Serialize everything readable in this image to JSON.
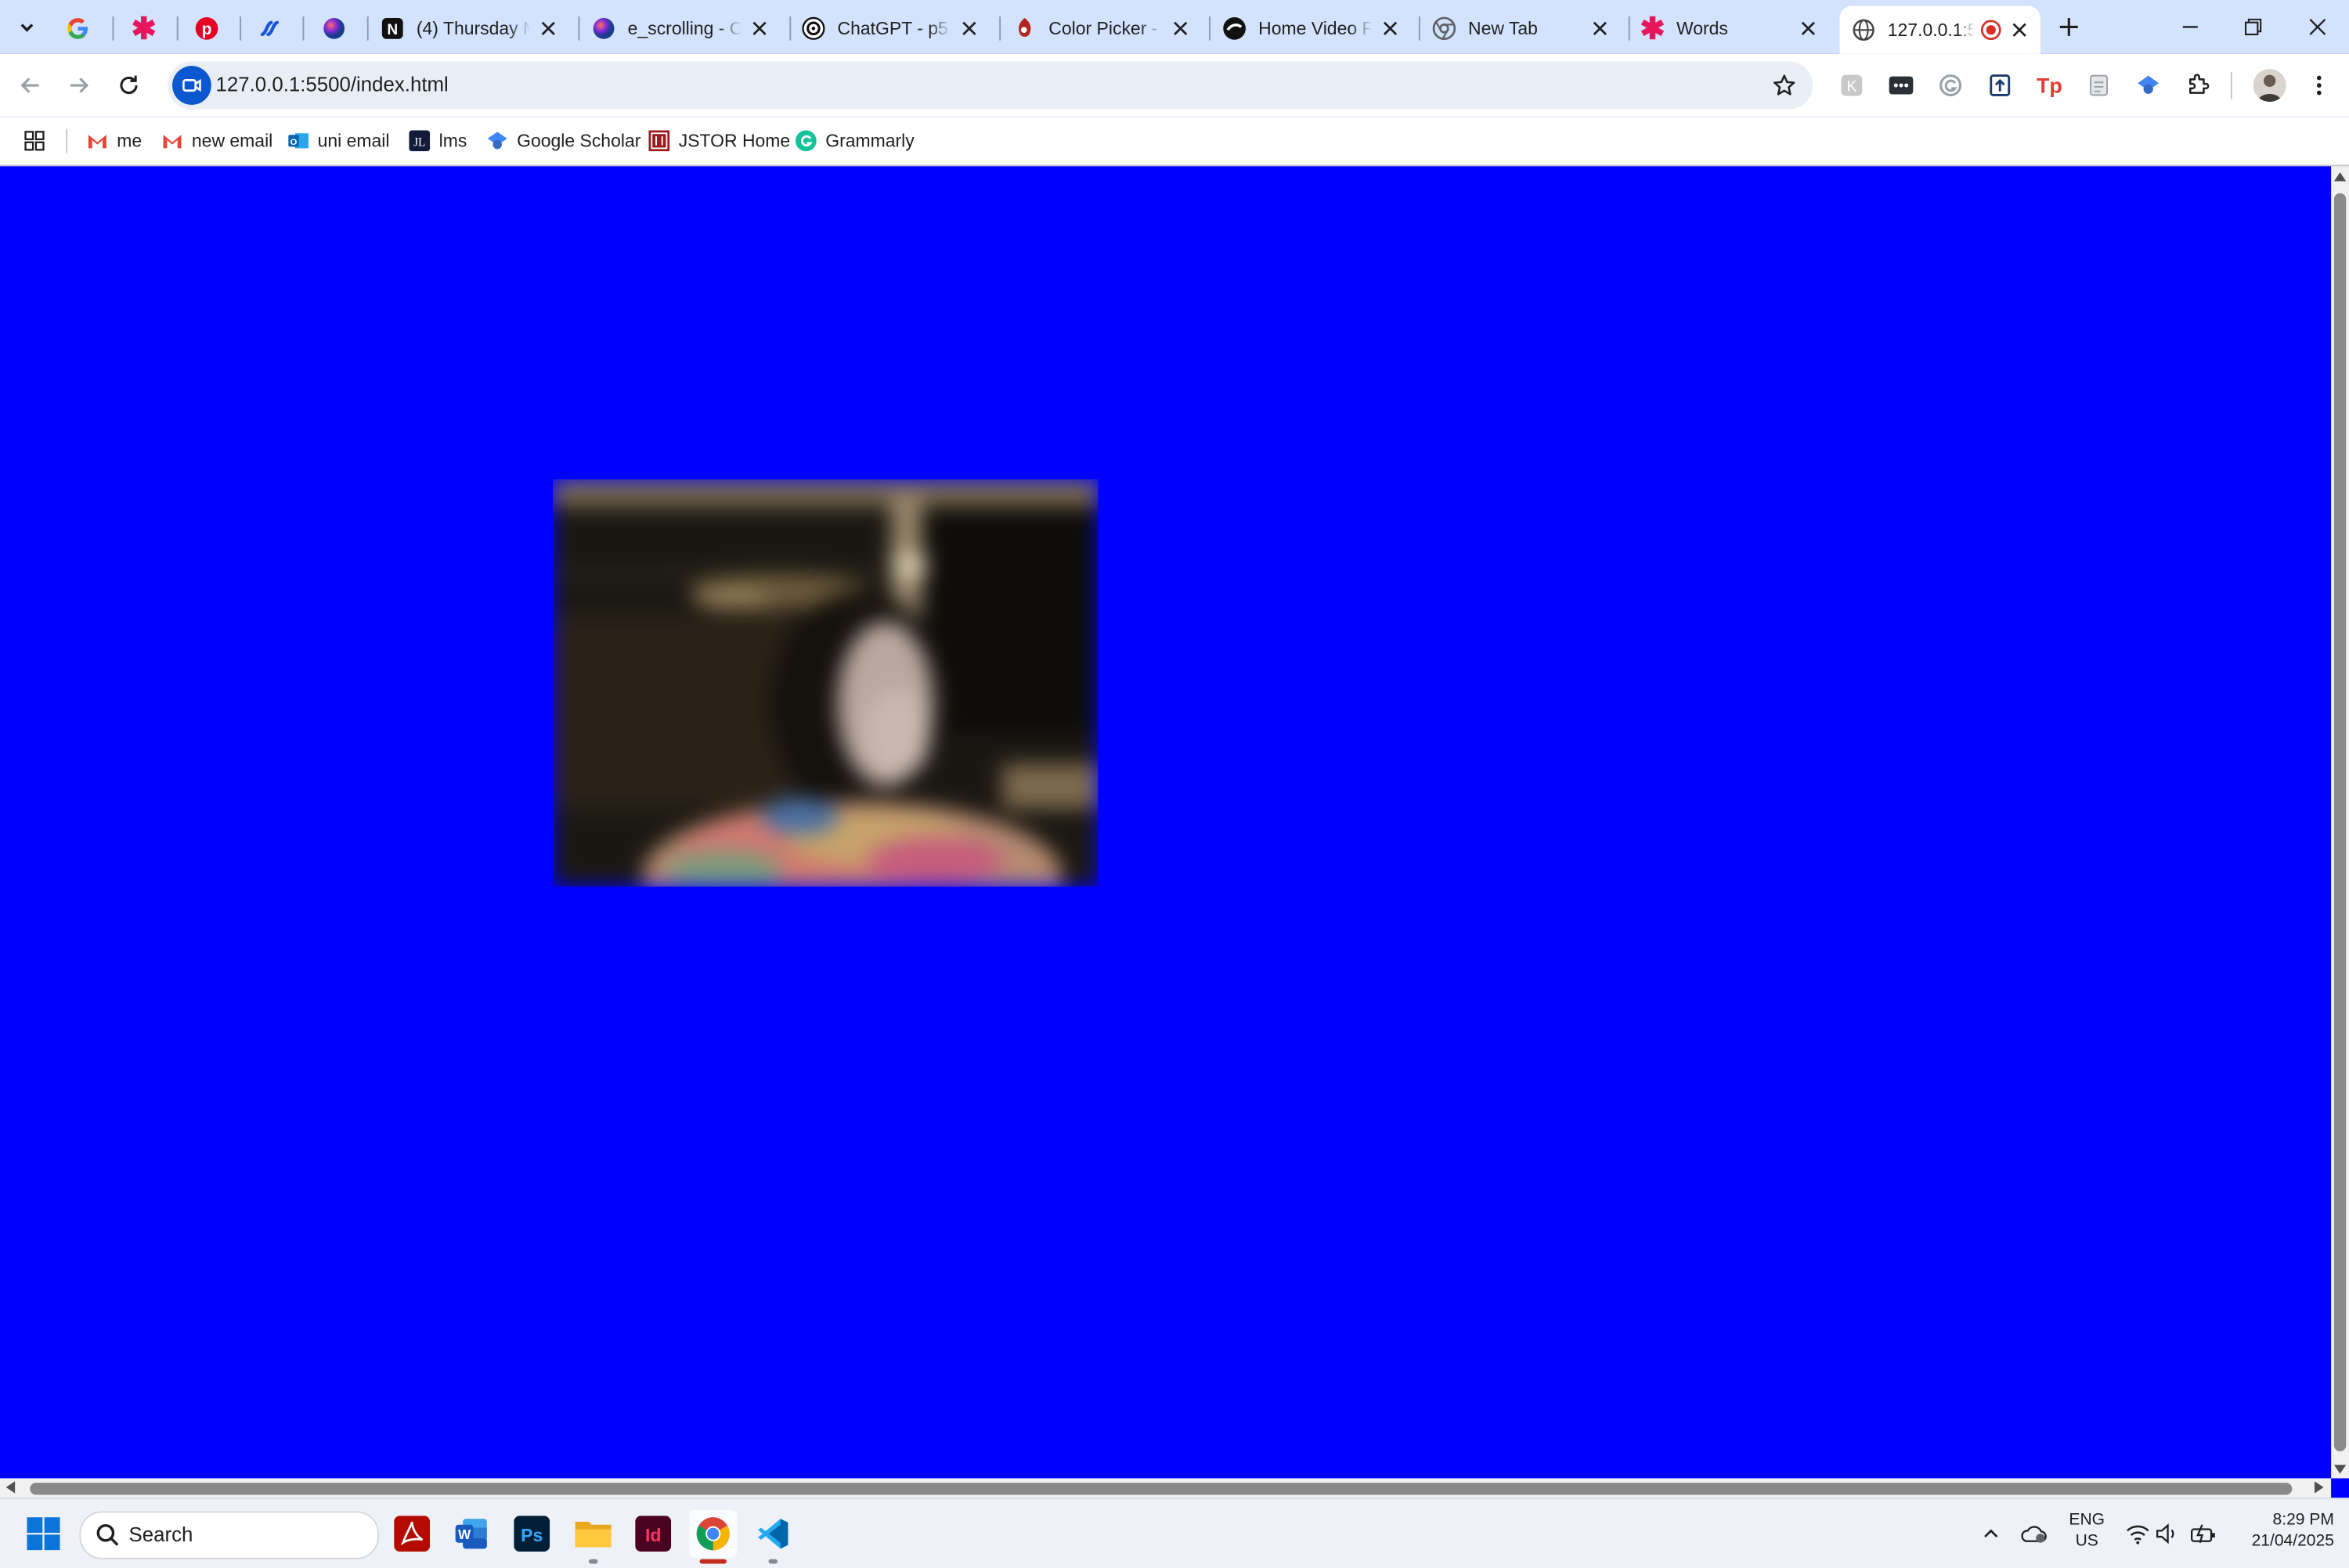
{
  "browser": {
    "tabs": [
      {
        "title": "",
        "icon": "google-icon"
      },
      {
        "title": "",
        "icon": "asterisk-icon"
      },
      {
        "title": "",
        "icon": "pinterest-icon"
      },
      {
        "title": "",
        "icon": "link-icon"
      },
      {
        "title": "",
        "icon": "ai-orb-icon"
      },
      {
        "title": "(4) Thursday Mo",
        "icon": "notion-icon"
      },
      {
        "title": "e_scrolling - Op",
        "icon": "ai-orb-icon"
      },
      {
        "title": "ChatGPT - p5.js",
        "icon": "chatgpt-icon"
      },
      {
        "title": "Color Picker - C",
        "icon": "color-picker-icon"
      },
      {
        "title": "Home Video Fo",
        "icon": "video-site-icon"
      },
      {
        "title": "New Tab",
        "icon": "chrome-icon"
      },
      {
        "title": "Words",
        "icon": "asterisk-icon"
      },
      {
        "title": "127.0.0.1:55",
        "icon": "globe-icon",
        "active": true,
        "recording": true
      }
    ],
    "address_bar": {
      "url": "127.0.0.1:5500/index.html"
    },
    "bookmarks": [
      {
        "label": "me",
        "icon": "gmail-icon"
      },
      {
        "label": "new email",
        "icon": "gmail-icon"
      },
      {
        "label": "uni email",
        "icon": "outlook-icon"
      },
      {
        "label": "lms",
        "icon": "lms-icon"
      },
      {
        "label": "Google Scholar",
        "icon": "scholar-icon"
      },
      {
        "label": "JSTOR Home",
        "icon": "jstor-icon"
      },
      {
        "label": "Grammarly",
        "icon": "grammarly-icon"
      }
    ],
    "extensions": [
      "ext-k-icon",
      "ext-dots-icon",
      "grammarly-ext-icon",
      "ext-upload-icon",
      "tp-icon",
      "ext-doc-icon",
      "scholar-ext-icon",
      "puzzle-icon",
      "profile-avatar"
    ]
  },
  "page": {
    "background_color": "#0000fe",
    "webcam_image": "blurred webcam feed"
  },
  "taskbar": {
    "search_placeholder": "Search",
    "apps": [
      "start-icon",
      "acrobat-icon",
      "word-icon",
      "photoshop-icon",
      "file-explorer-icon",
      "indesign-icon",
      "chrome-icon",
      "vscode-icon"
    ],
    "language": "ENG",
    "region": "US",
    "time": "8:29 PM",
    "date": "21/04/2025"
  }
}
